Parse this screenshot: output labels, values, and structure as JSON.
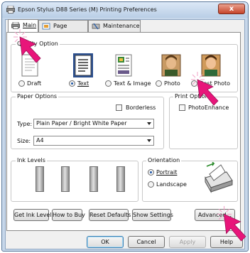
{
  "window": {
    "title": "Epson Stylus D88 Series (M) Printing Preferences",
    "close_label": "x"
  },
  "tabs": [
    {
      "label": "Main",
      "accel": "M"
    },
    {
      "label": "Page Layout"
    },
    {
      "label": "Maintenance"
    }
  ],
  "quality": {
    "group_title": "Quality Option",
    "options": [
      {
        "label": "Draft",
        "selected": false
      },
      {
        "label": "Text",
        "selected": true
      },
      {
        "label": "Text & Image",
        "selected": false
      },
      {
        "label": "Photo",
        "selected": false
      },
      {
        "label": "Best Photo",
        "selected": false
      }
    ]
  },
  "paper_options": {
    "group_title": "Paper Options",
    "borderless_label": "Borderless",
    "type_label": "Type:",
    "type_value": "Plain Paper / Bright White Paper",
    "size_label": "Size:",
    "size_value": "A4"
  },
  "print_options": {
    "group_title": "Print Options",
    "photo_enhance_label": "PhotoEnhance"
  },
  "ink_levels": {
    "group_title": "Ink Levels"
  },
  "orientation": {
    "group_title": "Orientation",
    "portrait_label": "Portrait",
    "landscape_label": "Landscape",
    "selected": "Portrait"
  },
  "action_buttons": [
    "Get Ink Levels",
    "How to Buy",
    "Reset Defaults",
    "Show Settings",
    "Advanced..."
  ],
  "dialog_buttons": [
    "OK",
    "Cancel",
    "Apply",
    "Help"
  ],
  "colors": {
    "accent_pink": "#e8157a",
    "title_blue": "#c7d7ea",
    "selected_blue": "#1f57a8"
  }
}
